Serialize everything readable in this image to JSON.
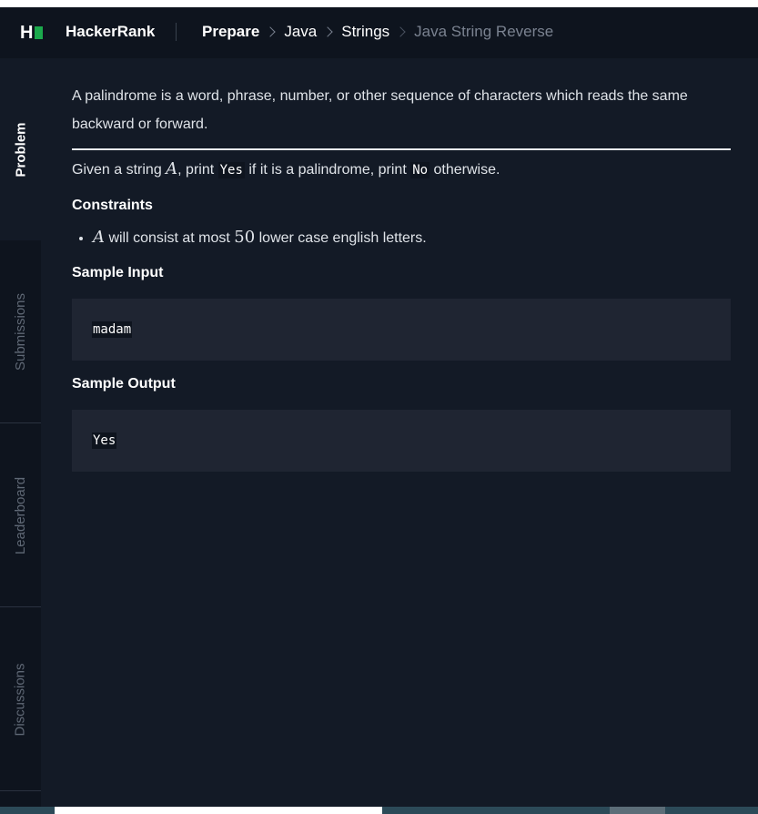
{
  "header": {
    "logo_text": "H",
    "brand": "HackerRank",
    "breadcrumb": {
      "prepare": "Prepare",
      "java": "Java",
      "strings": "Strings",
      "current": "Java String Reverse"
    }
  },
  "sidebar": {
    "tabs": [
      "Problem",
      "Submissions",
      "Leaderboard",
      "Discussions"
    ],
    "active": "Problem"
  },
  "problem": {
    "intro": "A palindrome is a word, phrase, number, or other sequence of characters which reads the same backward or forward.",
    "task_prefix": "Given a string ",
    "task_var": "A",
    "task_mid1": ", print ",
    "yes_code": "Yes",
    "task_mid2": " if it is a palindrome, print ",
    "no_code": "No",
    "task_suffix": " otherwise.",
    "constraints_heading": "Constraints",
    "constraint_var": "A",
    "constraint_mid": " will consist at most ",
    "constraint_num": "50",
    "constraint_suffix": " lower case english letters.",
    "sample_input_heading": "Sample Input",
    "sample_input": "madam",
    "sample_output_heading": "Sample Output",
    "sample_output": "Yes"
  },
  "colors": {
    "background": "#131a26",
    "header_bg": "#0e141e",
    "brand_green": "#1ba94c",
    "code_block_bg": "#1f2532"
  }
}
